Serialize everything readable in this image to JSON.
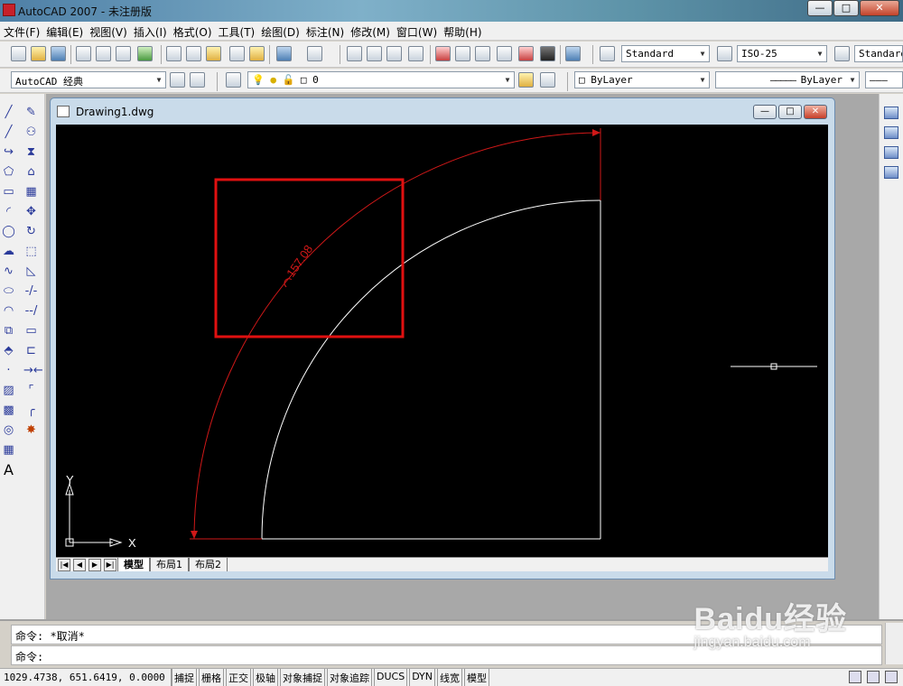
{
  "window": {
    "title": "AutoCAD 2007 - 未注册版",
    "min": "—",
    "max": "□",
    "close": "✕"
  },
  "menu": [
    "文件(F)",
    "编辑(E)",
    "视图(V)",
    "插入(I)",
    "格式(O)",
    "工具(T)",
    "绘图(D)",
    "标注(N)",
    "修改(M)",
    "窗口(W)",
    "帮助(H)"
  ],
  "toolbar": {
    "text_style": "Standard",
    "dim_style": "ISO-25",
    "table_style": "Standard",
    "workspace": "AutoCAD 经典",
    "layer": "0",
    "color": "ByLayer",
    "linetype": "ByLayer"
  },
  "drawing": {
    "name": "Drawing1.dwg",
    "arc_dimension": "157.08",
    "ucs_x": "X",
    "ucs_y": "Y",
    "colors": {
      "dimension": "#d01818",
      "geometry": "#ffffff",
      "highlight_box": "#e01010",
      "background": "#000000"
    }
  },
  "tabs": {
    "model": "模型",
    "layout1": "布局1",
    "layout2": "布局2"
  },
  "command": {
    "line1": "命令: *取消*",
    "line2": "命令:"
  },
  "status": {
    "coords": "1029.4738, 651.6419, 0.0000",
    "buttons": [
      "捕捉",
      "栅格",
      "正交",
      "极轴",
      "对象捕捉",
      "对象追踪",
      "DUCS",
      "DYN",
      "线宽",
      "模型"
    ]
  },
  "watermark": {
    "logo": "Baidu经验",
    "url": "jingyan.baidu.com"
  }
}
